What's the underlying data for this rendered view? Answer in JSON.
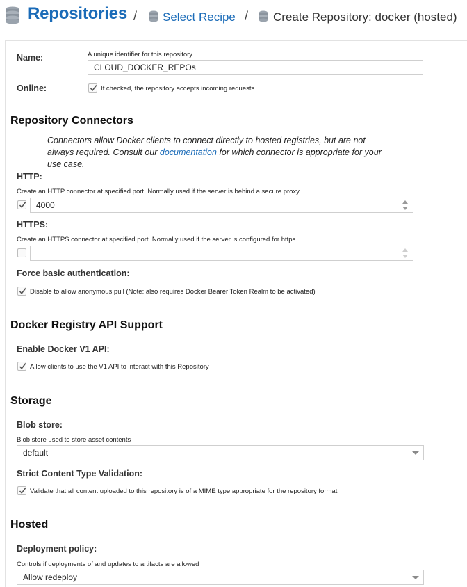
{
  "breadcrumb": {
    "title": "Repositories",
    "separator": "/",
    "step1": "Select Recipe",
    "step2": "Create Repository: docker (hosted)"
  },
  "name": {
    "label": "Name:",
    "hint": "A unique identifier for this repository",
    "value": "CLOUD_DOCKER_REPOs"
  },
  "online": {
    "label": "Online:",
    "checked": true,
    "text": "If checked, the repository accepts incoming requests"
  },
  "connectors": {
    "heading": "Repository Connectors",
    "desc_before": "Connectors allow Docker clients to connect directly to hosted registries, but are not always required. Consult our",
    "desc_link": "documentation",
    "desc_after": "for which connector is appropriate for your use case.",
    "http": {
      "label": "HTTP:",
      "hint": "Create an HTTP connector at specified port. Normally used if the server is behind a secure proxy.",
      "checked": true,
      "value": "4000"
    },
    "https": {
      "label": "HTTPS:",
      "hint": "Create an HTTPS connector at specified port. Normally used if the server is configured for https.",
      "checked": false,
      "value": ""
    },
    "force_auth": {
      "label": "Force basic authentication:",
      "checked": true,
      "text": "Disable to allow anonymous pull (Note: also requires Docker Bearer Token Realm to be activated)"
    }
  },
  "api": {
    "heading": "Docker Registry API Support",
    "v1_label": "Enable Docker V1 API:",
    "v1_checked": true,
    "v1_text": "Allow clients to use the V1 API to interact with this Repository"
  },
  "storage": {
    "heading": "Storage",
    "blob_label": "Blob store:",
    "blob_hint": "Blob store used to store asset contents",
    "blob_value": "default",
    "strict_label": "Strict Content Type Validation:",
    "strict_checked": true,
    "strict_text": "Validate that all content uploaded to this repository is of a MIME type appropriate for the repository format"
  },
  "hosted": {
    "heading": "Hosted",
    "deploy_label": "Deployment policy:",
    "deploy_hint": "Controls if deployments of and updates to artifacts are allowed",
    "deploy_value": "Allow redeploy"
  },
  "icons": {
    "breadcrumb": "database-icon",
    "check": "checkmark-icon",
    "spinner": "spinner-arrows-icon",
    "dropdown": "chevron-down-icon"
  },
  "colors": {
    "accent": "#1a6bb8",
    "border": "#cfcfcf"
  }
}
